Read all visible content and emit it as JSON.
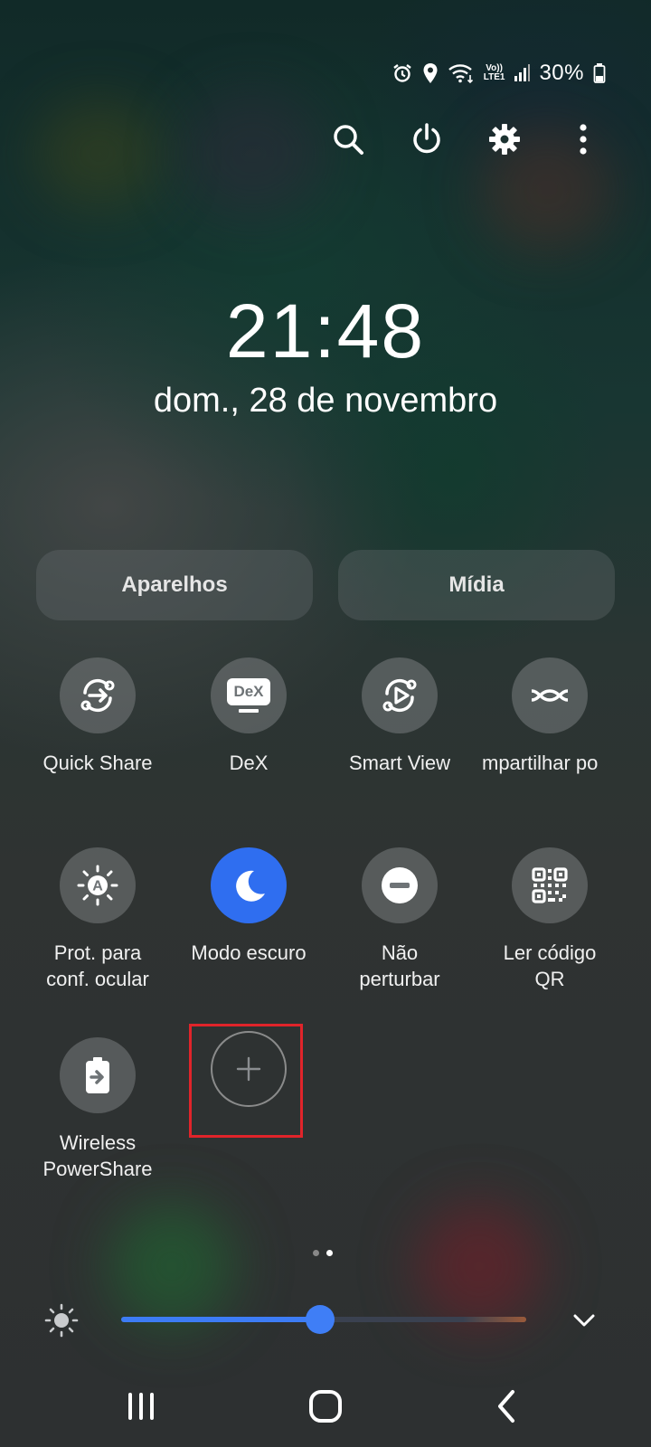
{
  "status_bar": {
    "battery_percent": "30%",
    "network_label": "LTE1",
    "icons": [
      "alarm-icon",
      "location-icon",
      "wifi-icon",
      "volte-icon",
      "signal-icon",
      "battery-icon"
    ]
  },
  "top_actions": [
    "search-icon",
    "power-icon",
    "settings-icon",
    "more-options-icon"
  ],
  "clock": {
    "time": "21:48",
    "date": "dom., 28 de novembro"
  },
  "tabs": [
    {
      "label": "Aparelhos"
    },
    {
      "label": "Mídia"
    }
  ],
  "tiles": [
    {
      "label": "Quick Share",
      "icon": "quick-share-icon",
      "active": false
    },
    {
      "label": "DeX",
      "icon": "dex-icon",
      "active": false,
      "icon_text": "DeX"
    },
    {
      "label": "Smart View",
      "icon": "smart-view-icon",
      "active": false
    },
    {
      "label": "mpartilhar po",
      "icon": "share-connection-icon",
      "active": false
    },
    {
      "label_line1": "Prot. para",
      "label_line2": "conf. ocular",
      "icon": "eye-comfort-icon",
      "active": false,
      "icon_text": "A"
    },
    {
      "label": "Modo escuro",
      "icon": "moon-icon",
      "active": true
    },
    {
      "label_line1": "Não",
      "label_line2": "perturbar",
      "icon": "do-not-disturb-icon",
      "active": false
    },
    {
      "label_line1": "Ler código",
      "label_line2": "QR",
      "icon": "qr-code-icon",
      "active": false
    },
    {
      "label_line1": "Wireless",
      "label_line2": "PowerShare",
      "icon": "wireless-powershare-icon",
      "active": false
    }
  ],
  "add_button": {
    "icon": "plus-icon"
  },
  "page_indicator": {
    "count": 2,
    "current": 2
  },
  "brightness": {
    "level_percent": 49,
    "icon": "sun-icon",
    "expand_icon": "chevron-down-icon"
  },
  "nav_bar": [
    "recent-apps-icon",
    "home-icon",
    "back-icon"
  ],
  "colors": {
    "accent": "#2f6ef0",
    "highlight_box": "#e0242a"
  }
}
